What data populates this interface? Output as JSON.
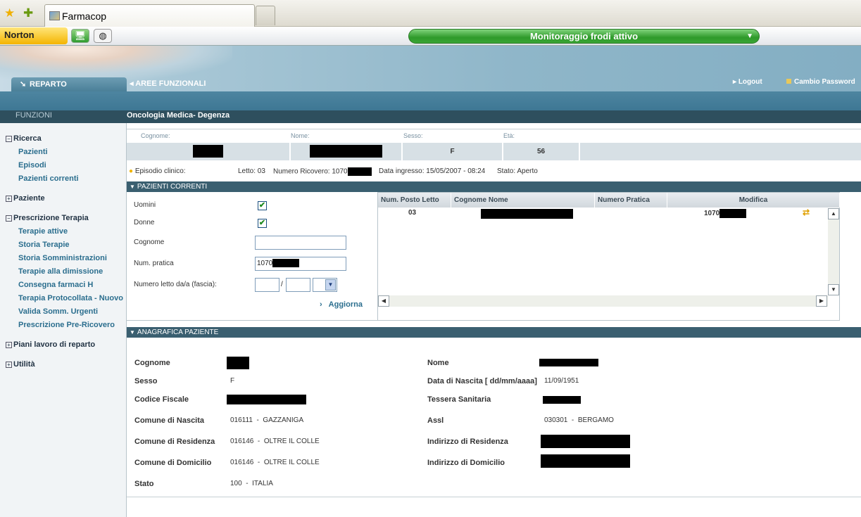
{
  "browser": {
    "tab_title": "Farmacop",
    "toolbar_brand": "Norton",
    "fraud_monitor": "Monitoraggio frodi attivo"
  },
  "header": {
    "tab_reparto": "REPARTO",
    "tab_aree": "AREE FUNZIONALI",
    "logout": "Logout",
    "cambio_password": "Cambio Password",
    "funzioni_label": "FUNZIONI",
    "department_title": "Oncologia Medica- Degenza"
  },
  "sidebar": {
    "groups": [
      {
        "label": "Ricerca",
        "expanded": true,
        "items": [
          "Pazienti",
          "Episodi",
          "Pazienti correnti"
        ]
      },
      {
        "label": "Paziente",
        "expanded": false,
        "items": []
      },
      {
        "label": "Prescrizione Terapia",
        "expanded": true,
        "items": [
          "Terapie attive",
          "Storia Terapie",
          "Storia Somministrazioni",
          "Terapie alla dimissione",
          "Consegna farmaci H",
          "Terapia Protocollata - Nuovo",
          "Valida Somm. Urgenti",
          "Prescrizione Pre-Ricovero"
        ]
      },
      {
        "label": "Piani lavoro di reparto",
        "expanded": false,
        "items": []
      },
      {
        "label": "Utilità",
        "expanded": false,
        "items": []
      }
    ]
  },
  "patient_header": {
    "labels": {
      "cognome": "Cognome:",
      "nome": "Nome:",
      "sesso": "Sesso:",
      "eta": "Età:"
    },
    "sesso": "F",
    "eta": "56"
  },
  "episodio": {
    "label": "Episodio clinico:",
    "letto": "Letto: 03",
    "numero_ricovero_label": "Numero Ricovero: 1070",
    "data_ingresso": "Data ingresso: 15/05/2007 - 08:24",
    "stato": "Stato: Aperto"
  },
  "pazienti_correnti": {
    "title": "PAZIENTI CORRENTI",
    "filters": {
      "uomini_label": "Uomini",
      "uomini_checked": true,
      "donne_label": "Donne",
      "donne_checked": true,
      "cognome_label": "Cognome",
      "cognome_value": "",
      "num_pratica_label": "Num. pratica",
      "num_pratica_value": "1070",
      "numero_letto_label": "Numero letto da/a (fascia):",
      "letto_sep": "/",
      "aggiorna": "Aggiorna"
    },
    "grid": {
      "columns": [
        "Num. Posto Letto",
        "Cognome Nome",
        "Numero Pratica",
        "Modifica"
      ],
      "rows": [
        {
          "posto_letto": "03",
          "numero_pratica": "1070"
        }
      ]
    }
  },
  "anagrafica": {
    "title": "ANAGRAFICA PAZIENTE",
    "labels": {
      "cognome": "Cognome",
      "nome": "Nome",
      "sesso": "Sesso",
      "data_nascita": "Data di Nascita [ dd/mm/aaaa]",
      "codice_fiscale": "Codice Fiscale",
      "tessera": "Tessera Sanitaria",
      "comune_nascita": "Comune di Nascita",
      "assl": "Assl",
      "comune_residenza": "Comune di Residenza",
      "indirizzo_residenza": "Indirizzo di Residenza",
      "comune_domicilio": "Comune di Domicilio",
      "indirizzo_domicilio": "Indirizzo di Domicilio",
      "stato": "Stato"
    },
    "values": {
      "sesso": "F",
      "data_nascita": "11/09/1951",
      "comune_nascita": "016111  -  GAZZANIGA",
      "assl": "030301  -  BERGAMO",
      "comune_residenza": "016146  -  OLTRE IL COLLE",
      "comune_domicilio": "016146  -  OLTRE IL COLLE",
      "stato": "100  -  ITALIA"
    }
  },
  "colors": {
    "header_dark": "#2e4f5e",
    "section_bar": "#3a5f70",
    "link": "#2b6e8e",
    "accent_green": "#2e9a2a"
  }
}
